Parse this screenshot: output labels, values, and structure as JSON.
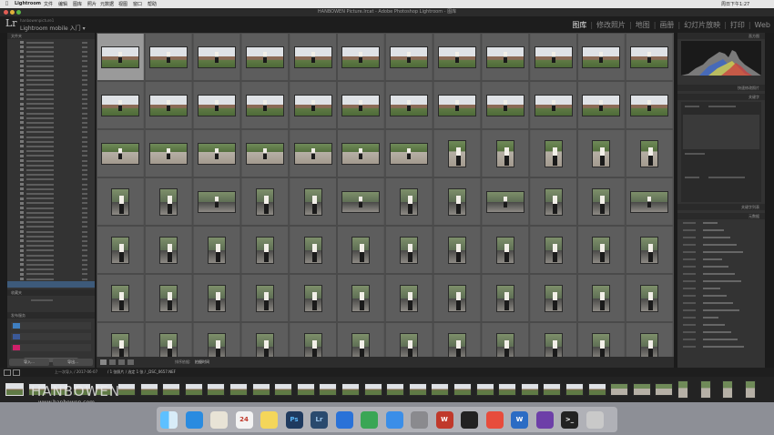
{
  "menubar": {
    "app_name": "Lightroom",
    "menus": [
      "文件",
      "编辑",
      "图库",
      "照片",
      "元数据",
      "视图",
      "窗口",
      "帮助"
    ],
    "clock": "周日下午1:27"
  },
  "window": {
    "title": "HANBOWEN Picture.lrcat - Adobe Photoshop Lightroom - 图库"
  },
  "identity_plate": {
    "app": "Lr",
    "subtitle": "hanbowenpicture1",
    "label": "Lightroom mobile 入门 ▾"
  },
  "modules": [
    "图库",
    "修改照片",
    "地图",
    "画册",
    "幻灯片放映",
    "打印",
    "Web"
  ],
  "left_panel": {
    "folders_header": "文件夹",
    "collections_header": "收藏夹",
    "publish_header": "发布服务",
    "import_button": "导入...",
    "export_button": "导出..."
  },
  "right_panel": {
    "histogram_header": "直方图",
    "quick_develop_header": "快速修改照片",
    "keywords_header": "关键字",
    "keyword_list_header": "关键字列表",
    "metadata_header": "元数据"
  },
  "toolbar": {
    "sort_label": "排序依据:",
    "sort_value": "拍摄时间"
  },
  "filmstrip": {
    "path": "上一次导入 / 2017-06-07",
    "selected": "/ 1 张照片 / 选定 1 张 / _DSC_0657.NEF"
  },
  "watermark": {
    "text": "HANBOWEN",
    "url": "www.hanbowen.com"
  },
  "dock": {
    "apps": [
      "finder",
      "safari",
      "photos",
      "calendar",
      "notes",
      "photoshop",
      "lightroom",
      "keynote",
      "numbers",
      "appstore",
      "preferences",
      "wps",
      "qq",
      "meitu",
      "word",
      "xmind",
      "terminal",
      "trash"
    ]
  }
}
